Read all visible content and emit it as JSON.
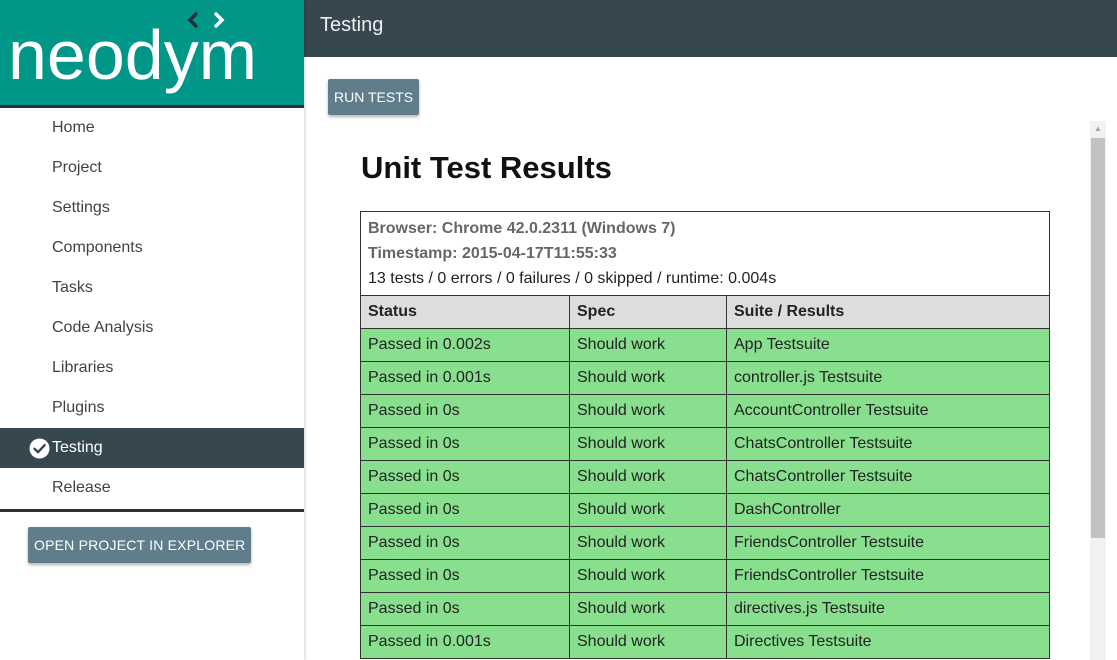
{
  "logo": {
    "text": "neodym"
  },
  "sidebar": {
    "items": [
      {
        "label": "Home",
        "active": false
      },
      {
        "label": "Project",
        "active": false
      },
      {
        "label": "Settings",
        "active": false
      },
      {
        "label": "Components",
        "active": false
      },
      {
        "label": "Tasks",
        "active": false
      },
      {
        "label": "Code Analysis",
        "active": false
      },
      {
        "label": "Libraries",
        "active": false
      },
      {
        "label": "Plugins",
        "active": false
      },
      {
        "label": "Testing",
        "active": true,
        "icon": "check-circle-icon"
      },
      {
        "label": "Release",
        "active": false
      }
    ],
    "explorer_button": "OPEN PROJECT IN EXPLORER"
  },
  "header": {
    "title": "Testing"
  },
  "main": {
    "run_button": "RUN TESTS",
    "results": {
      "title": "Unit Test Results",
      "browser": "Browser: Chrome 42.0.2311 (Windows 7)",
      "timestamp": "Timestamp: 2015-04-17T11:55:33",
      "summary": "13 tests / 0 errors / 0 failures / 0 skipped / runtime: 0.004s",
      "columns": [
        "Status",
        "Spec",
        "Suite / Results"
      ],
      "rows": [
        {
          "status": "Passed in 0.002s",
          "spec": "Should work",
          "suite": "App Testsuite"
        },
        {
          "status": "Passed in 0.001s",
          "spec": "Should work",
          "suite": "controller.js Testsuite"
        },
        {
          "status": "Passed in 0s",
          "spec": "Should work",
          "suite": "AccountController Testsuite"
        },
        {
          "status": "Passed in 0s",
          "spec": "Should work",
          "suite": "ChatsController Testsuite"
        },
        {
          "status": "Passed in 0s",
          "spec": "Should work",
          "suite": "ChatsController Testsuite"
        },
        {
          "status": "Passed in 0s",
          "spec": "Should work",
          "suite": "DashController"
        },
        {
          "status": "Passed in 0s",
          "spec": "Should work",
          "suite": "FriendsController Testsuite"
        },
        {
          "status": "Passed in 0s",
          "spec": "Should work",
          "suite": "FriendsController Testsuite"
        },
        {
          "status": "Passed in 0s",
          "spec": "Should work",
          "suite": "directives.js Testsuite"
        },
        {
          "status": "Passed in 0.001s",
          "spec": "Should work",
          "suite": "Directives Testsuite"
        }
      ]
    }
  },
  "colors": {
    "brand": "#009688",
    "header": "#37474f",
    "button": "#607d8b",
    "pass_row": "#88e08e"
  }
}
